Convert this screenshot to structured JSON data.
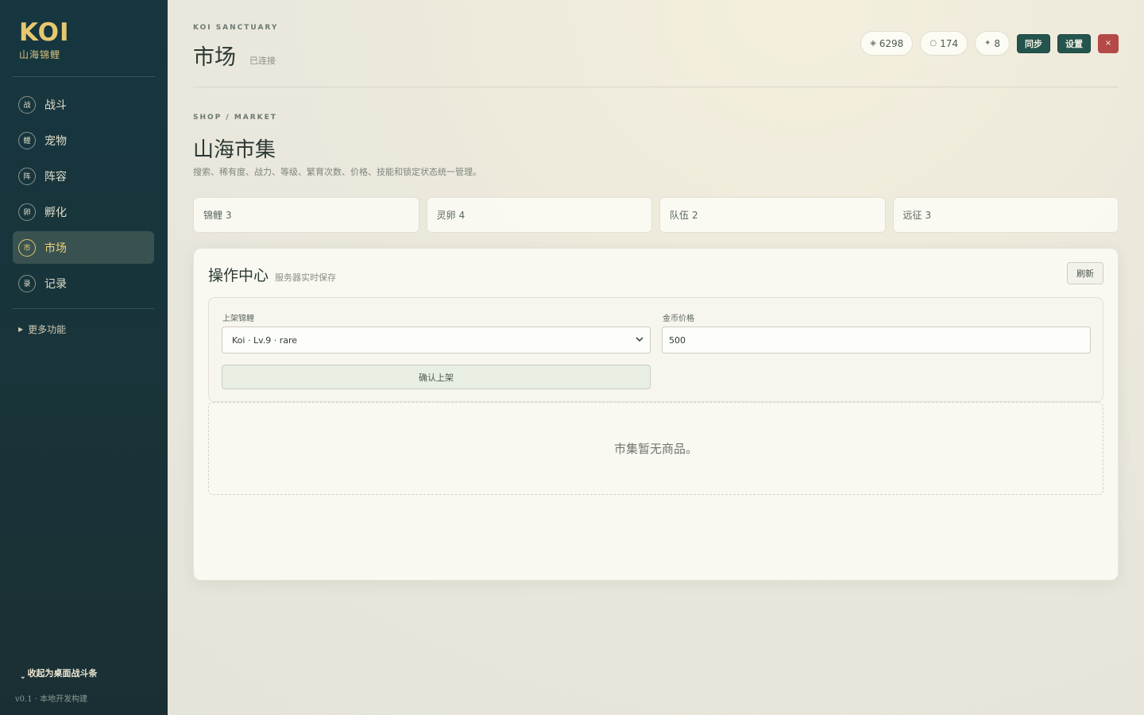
{
  "sidebar": {
    "logo_title": "KOI",
    "logo_subtitle": "山海锦鲤",
    "items": [
      {
        "badge": "战",
        "label": "战斗",
        "active": false
      },
      {
        "badge": "鲤",
        "label": "宠物",
        "active": false
      },
      {
        "badge": "阵",
        "label": "阵容",
        "active": false
      },
      {
        "badge": "卵",
        "label": "孵化",
        "active": false
      },
      {
        "badge": "市",
        "label": "市场",
        "active": true
      },
      {
        "badge": "录",
        "label": "记录",
        "active": false
      }
    ],
    "more_label": "更多功能",
    "collapse_label": "收起为桌面战斗条",
    "version": "v0.1 · 本地开发构建"
  },
  "header": {
    "kicker": "KOI SANCTUARY",
    "title": "市场",
    "status": "已连接",
    "currencies": [
      {
        "icon": "◈",
        "icon_name": "gem-icon",
        "value": "6298"
      },
      {
        "icon": "○",
        "icon_name": "ring-icon",
        "value": "174"
      },
      {
        "icon": "✦",
        "icon_name": "star-icon",
        "value": "8"
      }
    ],
    "sync_label": "同步",
    "settings_label": "设置",
    "close_label": "×"
  },
  "section": {
    "kicker": "SHOP / MARKET",
    "title": "山海市集",
    "description": "搜索、稀有度、战力、等级、繁育次数、价格、技能和锁定状态统一管理。"
  },
  "stats": [
    {
      "label": "锦鲤",
      "value": "3"
    },
    {
      "label": "灵卵",
      "value": "4"
    },
    {
      "label": "队伍",
      "value": "2"
    },
    {
      "label": "远征",
      "value": "3"
    }
  ],
  "panel": {
    "title": "操作中心",
    "subtitle": "服务器实时保存",
    "refresh_label": "刷新",
    "listing_label": "上架锦鲤",
    "listing_selected": "Koi · Lv.9 · rare",
    "price_label": "金币价格",
    "price_value": "500",
    "confirm_label": "确认上架",
    "empty_text": "市集暂无商品。"
  },
  "colors": {
    "sidebar_bg": "#163640",
    "accent_gold": "#e7c870",
    "primary_button": "#24544d",
    "danger_button": "#b34a48"
  }
}
